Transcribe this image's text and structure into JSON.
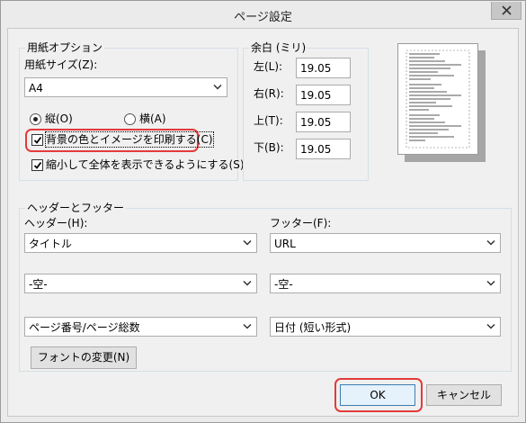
{
  "window": {
    "title": "ページ設定",
    "close_icon": "close-icon"
  },
  "paper": {
    "group_title": "用紙オプション",
    "size_label": "用紙サイズ(Z):",
    "size_value": "A4",
    "portrait_label": "縦(O)",
    "landscape_label": "横(A)",
    "orientation_selected": "portrait",
    "print_background_label": "背景の色とイメージを印刷する(C)",
    "print_background_checked": true,
    "shrink_to_fit_label": "縮小して全体を表示できるようにする(S)",
    "shrink_to_fit_checked": true
  },
  "margins": {
    "group_title": "余白 (ミリ)",
    "left_label": "左(L):",
    "left_value": "19.05",
    "right_label": "右(R):",
    "right_value": "19.05",
    "top_label": "上(T):",
    "top_value": "19.05",
    "bottom_label": "下(B):",
    "bottom_value": "19.05"
  },
  "header_footer": {
    "group_title": "ヘッダーとフッター",
    "header_label": "ヘッダー(H):",
    "footer_label": "フッター(F):",
    "header_row1": "タイトル",
    "footer_row1": "URL",
    "header_row2": "-空-",
    "footer_row2": "-空-",
    "header_row3": "ページ番号/ページ総数",
    "footer_row3": "日付 (短い形式)",
    "font_button": "フォントの変更(N)"
  },
  "buttons": {
    "ok": "OK",
    "cancel": "キャンセル"
  },
  "annotation_color": "#e23b3b"
}
